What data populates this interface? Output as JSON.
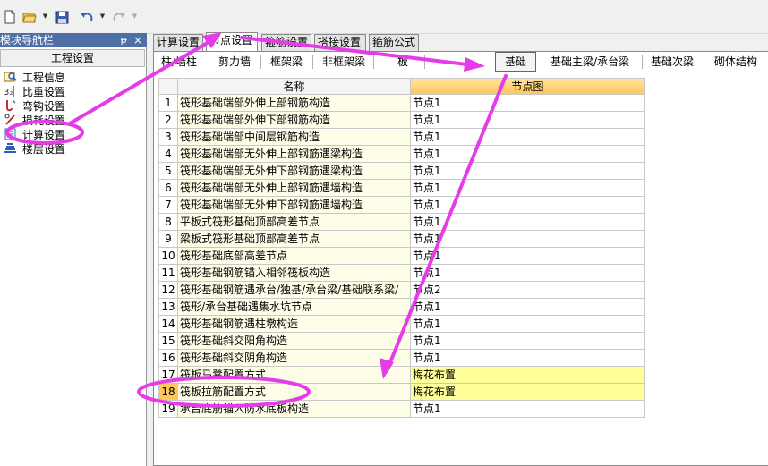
{
  "toolbar": {
    "icons": [
      "new-file-icon",
      "open-folder-icon",
      "save-icon",
      "undo-icon",
      "redo-icon"
    ]
  },
  "nav": {
    "header": "模块导航栏",
    "pin": "ᵽ",
    "close": "×",
    "title": "工程设置",
    "items": [
      {
        "label": "工程信息",
        "icon": "project-info-icon"
      },
      {
        "label": "比重设置",
        "icon": "weight-icon"
      },
      {
        "label": "弯钩设置",
        "icon": "hook-icon"
      },
      {
        "label": "损耗设置",
        "icon": "loss-icon"
      },
      {
        "label": "计算设置",
        "icon": "calc-settings-icon"
      },
      {
        "label": "楼层设置",
        "icon": "floor-icon"
      }
    ]
  },
  "tabs": [
    {
      "label": "计算设置",
      "active": false
    },
    {
      "label": "节点设置",
      "active": true
    },
    {
      "label": "箍筋设置",
      "active": false
    },
    {
      "label": "搭接设置",
      "active": false
    },
    {
      "label": "箍筋公式",
      "active": false
    }
  ],
  "subtabs": [
    {
      "label": "柱/墙柱",
      "active": false
    },
    {
      "label": "剪力墙",
      "active": false
    },
    {
      "label": "框架梁",
      "active": false
    },
    {
      "label": "非框架梁",
      "active": false
    },
    {
      "label": "板",
      "active": false
    },
    {
      "label": "基础",
      "active": true
    },
    {
      "label": "基础主梁/承台梁",
      "active": false
    },
    {
      "label": "基础次梁",
      "active": false
    },
    {
      "label": "砌体结构",
      "active": false
    }
  ],
  "grid": {
    "headers": {
      "name": "名称",
      "node": "节点图"
    },
    "rows": [
      {
        "num": "1",
        "name": "筏形基础端部外伸上部钢筋构造",
        "node": "节点1"
      },
      {
        "num": "2",
        "name": "筏形基础端部外伸下部钢筋构造",
        "node": "节点1"
      },
      {
        "num": "3",
        "name": "筏形基础端部中间层钢筋构造",
        "node": "节点1"
      },
      {
        "num": "4",
        "name": "筏形基础端部无外伸上部钢筋遇梁构造",
        "node": "节点1"
      },
      {
        "num": "5",
        "name": "筏形基础端部无外伸下部钢筋遇梁构造",
        "node": "节点1"
      },
      {
        "num": "6",
        "name": "筏形基础端部无外伸上部钢筋遇墙构造",
        "node": "节点1"
      },
      {
        "num": "7",
        "name": "筏形基础端部无外伸下部钢筋遇墙构造",
        "node": "节点1"
      },
      {
        "num": "8",
        "name": "平板式筏形基础顶部高差节点",
        "node": "节点1"
      },
      {
        "num": "9",
        "name": "梁板式筏形基础顶部高差节点",
        "node": "节点1"
      },
      {
        "num": "10",
        "name": "筏形基础底部高差节点",
        "node": "节点1"
      },
      {
        "num": "11",
        "name": "筏形基础钢筋锚入相邻筏板构造",
        "node": "节点1"
      },
      {
        "num": "12",
        "name": "筏形基础钢筋遇承台/独基/承台梁/基础联系梁/",
        "node": "节点2"
      },
      {
        "num": "13",
        "name": "筏形/承台基础遇集水坑节点",
        "node": "节点1"
      },
      {
        "num": "14",
        "name": "筏形基础钢筋遇柱墩构造",
        "node": "节点1"
      },
      {
        "num": "15",
        "name": "筏形基础斜交阳角构造",
        "node": "节点1"
      },
      {
        "num": "16",
        "name": "筏形基础斜交阴角构造",
        "node": "节点1"
      },
      {
        "num": "17",
        "name": "筏板马凳配置方式",
        "node": "梅花布置",
        "highlight": true
      },
      {
        "num": "18",
        "name": "筏板拉筋配置方式",
        "node": "梅花布置",
        "highlight": true,
        "selected": true
      },
      {
        "num": "19",
        "name": "承台底筋锚入防水底板构造",
        "node": "节点1"
      }
    ]
  },
  "colors": {
    "annotation": "#e43ce8",
    "nav_header": "#4f6fa8",
    "node_header": "#ffc65a",
    "highlight": "#ffff99"
  }
}
